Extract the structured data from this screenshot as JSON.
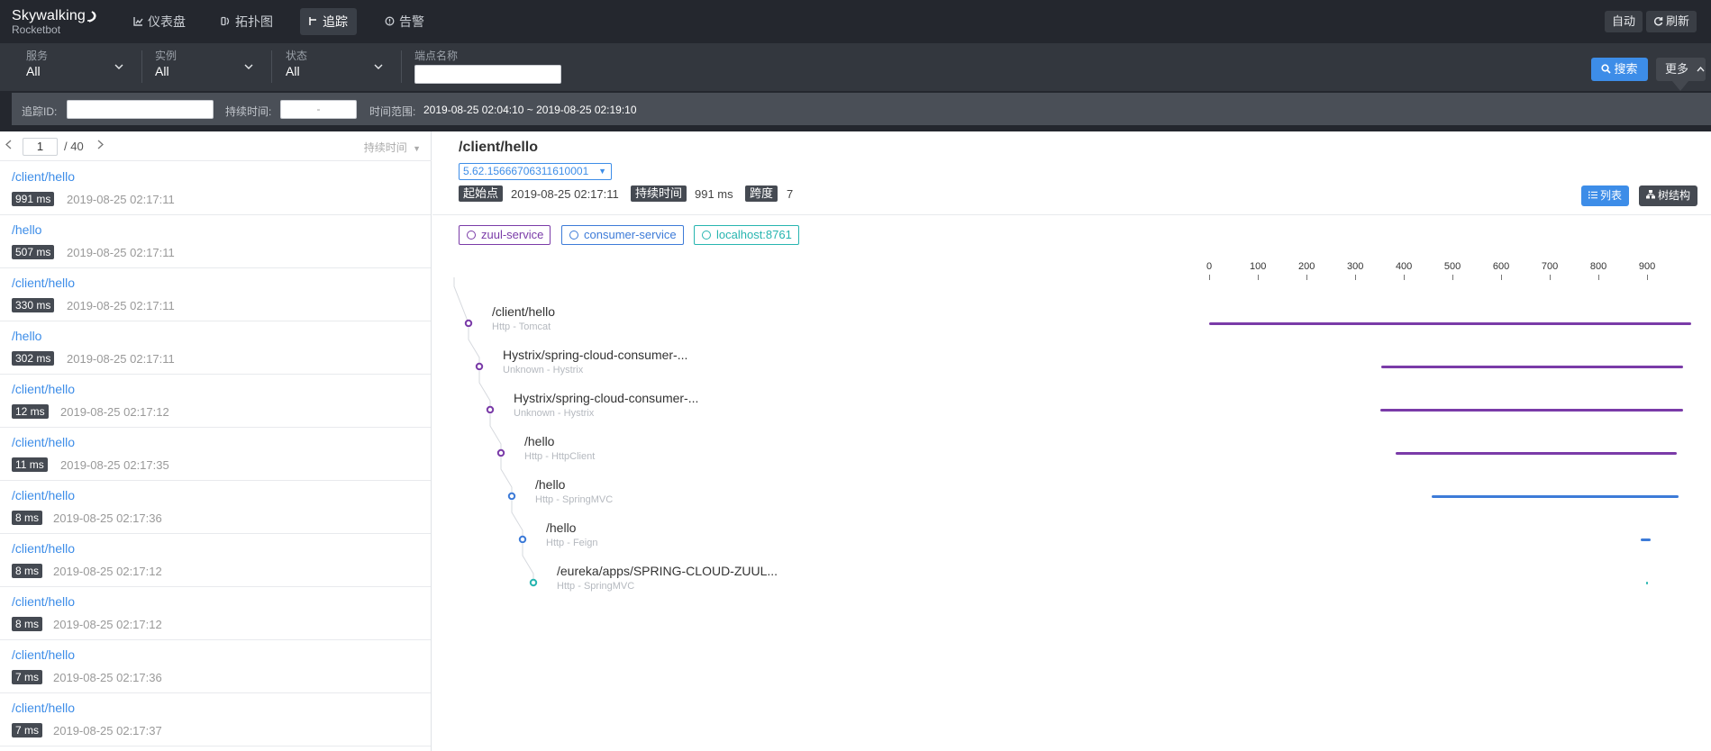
{
  "brand": {
    "line1": "Skywalking",
    "line2": "Rocketbot"
  },
  "nav": {
    "items": [
      {
        "label": "仪表盘",
        "icon": "dashboard-icon"
      },
      {
        "label": "拓扑图",
        "icon": "topology-icon"
      },
      {
        "label": "追踪",
        "icon": "trace-icon",
        "active": true
      },
      {
        "label": "告警",
        "icon": "alarm-icon"
      }
    ],
    "auto_label": "自动",
    "refresh_label": "刷新"
  },
  "filters": {
    "service": {
      "label": "服务",
      "value": "All"
    },
    "instance": {
      "label": "实例",
      "value": "All"
    },
    "status": {
      "label": "状态",
      "value": "All"
    },
    "endpoint": {
      "label": "端点名称",
      "value": ""
    },
    "search_label": "搜索",
    "more_label": "更多"
  },
  "subfilters": {
    "trace_id_label": "追踪ID:",
    "trace_id_value": "",
    "duration_label": "持续时间:",
    "duration_value": "-",
    "time_range_label": "时间范围:",
    "time_range_value": "2019-08-25 02:04:10 ~ 2019-08-25 02:19:10"
  },
  "list": {
    "page": "1",
    "total": "/ 40",
    "sort_label": "持续时间",
    "traces": [
      {
        "endpoint": "/client/hello",
        "duration": "991 ms",
        "time": "2019-08-25 02:17:11"
      },
      {
        "endpoint": "/hello",
        "duration": "507 ms",
        "time": "2019-08-25 02:17:11"
      },
      {
        "endpoint": "/client/hello",
        "duration": "330 ms",
        "time": "2019-08-25 02:17:11"
      },
      {
        "endpoint": "/hello",
        "duration": "302 ms",
        "time": "2019-08-25 02:17:11"
      },
      {
        "endpoint": "/client/hello",
        "duration": "12 ms",
        "time": "2019-08-25 02:17:12"
      },
      {
        "endpoint": "/client/hello",
        "duration": "11 ms",
        "time": "2019-08-25 02:17:35"
      },
      {
        "endpoint": "/client/hello",
        "duration": "8 ms",
        "time": "2019-08-25 02:17:36"
      },
      {
        "endpoint": "/client/hello",
        "duration": "8 ms",
        "time": "2019-08-25 02:17:12"
      },
      {
        "endpoint": "/client/hello",
        "duration": "8 ms",
        "time": "2019-08-25 02:17:12"
      },
      {
        "endpoint": "/client/hello",
        "duration": "7 ms",
        "time": "2019-08-25 02:17:36"
      },
      {
        "endpoint": "/client/hello",
        "duration": "7 ms",
        "time": "2019-08-25 02:17:37"
      }
    ]
  },
  "detail": {
    "title": "/client/hello",
    "trace_id": "5.62.15666706311610001",
    "start_label": "起始点",
    "start_value": "2019-08-25 02:17:11",
    "duration_label": "持续时间",
    "duration_value": "991 ms",
    "span_label": "跨度",
    "span_value": "7",
    "list_btn": "列表",
    "tree_btn": "树结构",
    "services": [
      {
        "name": "zuul-service",
        "color": "#7a3ba8"
      },
      {
        "name": "consumer-service",
        "color": "#3d7bd8"
      },
      {
        "name": "localhost:8761",
        "color": "#27b5b0"
      }
    ],
    "axis_ticks": [
      "0",
      "100",
      "200",
      "300",
      "400",
      "500",
      "600",
      "700",
      "800",
      "900"
    ],
    "axis_max": 991,
    "spans": [
      {
        "name": "/client/hello",
        "sub": "Http - Tomcat",
        "start": 0,
        "end": 991,
        "service": 0
      },
      {
        "name": "Hystrix/spring-cloud-consumer-...",
        "sub": "Unknown - Hystrix",
        "start": 353,
        "end": 974,
        "service": 0
      },
      {
        "name": "Hystrix/spring-cloud-consumer-...",
        "sub": "Unknown - Hystrix",
        "start": 352,
        "end": 974,
        "service": 0
      },
      {
        "name": "/hello",
        "sub": "Http - HttpClient",
        "start": 383,
        "end": 961,
        "service": 0
      },
      {
        "name": "/hello",
        "sub": "Http - SpringMVC",
        "start": 458,
        "end": 966,
        "service": 1
      },
      {
        "name": "/hello",
        "sub": "Http - Feign",
        "start": 887,
        "end": 907,
        "service": 1
      },
      {
        "name": "/eureka/apps/SPRING-CLOUD-ZUUL...",
        "sub": "Http - SpringMVC",
        "start": 899,
        "end": 902,
        "service": 2
      }
    ]
  }
}
